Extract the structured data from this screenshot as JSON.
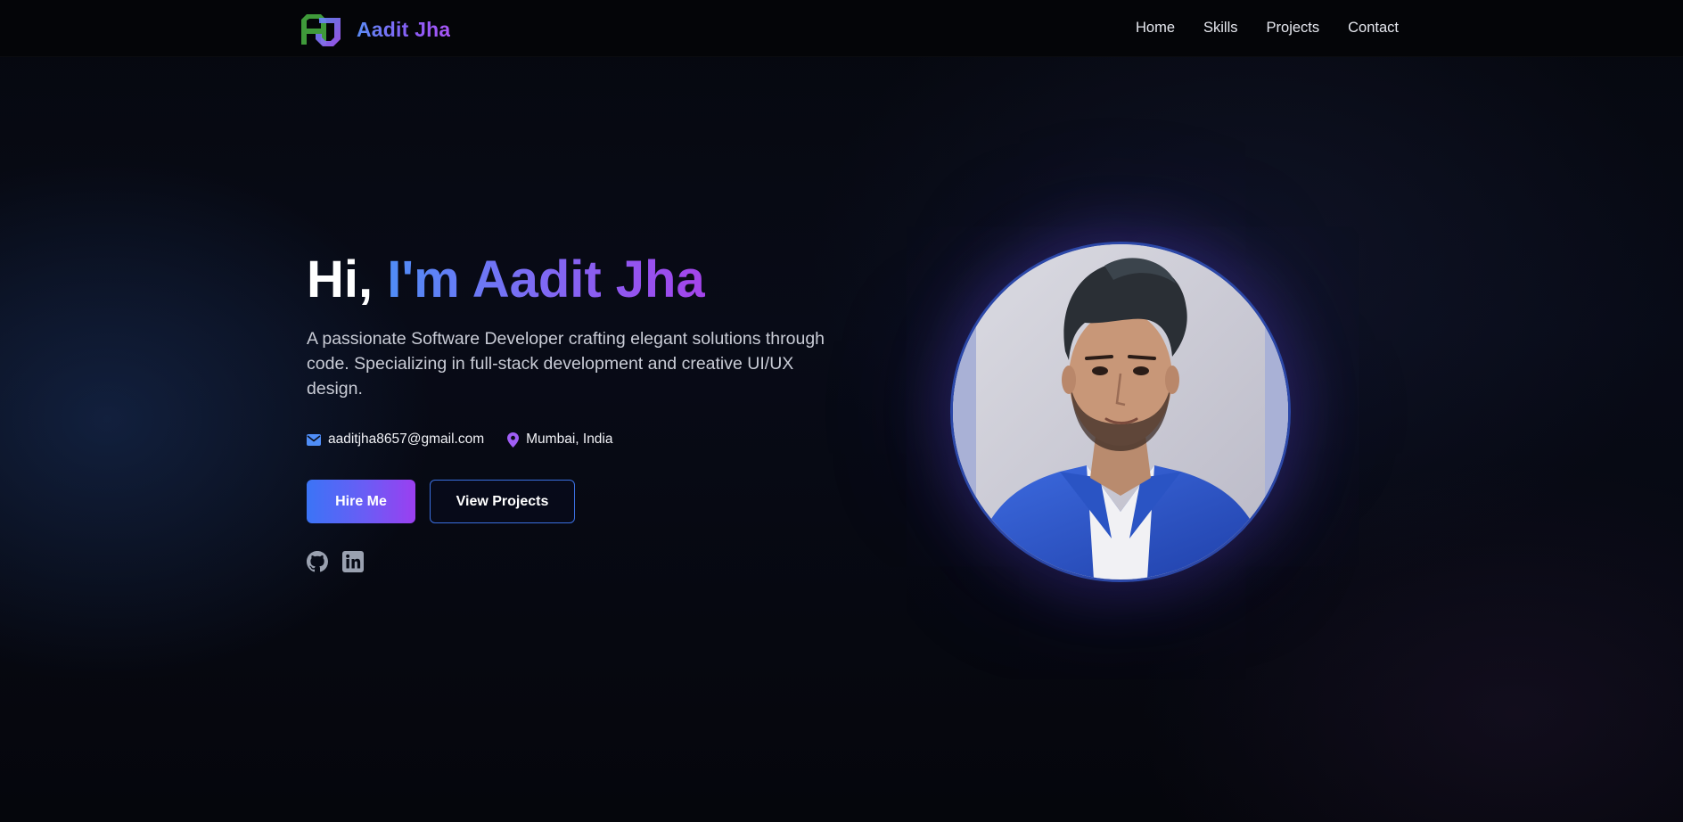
{
  "header": {
    "brand": "Aadit Jha",
    "logo_icon": "aj-monogram-logo",
    "nav": [
      {
        "label": "Home"
      },
      {
        "label": "Skills"
      },
      {
        "label": "Projects"
      },
      {
        "label": "Contact"
      }
    ]
  },
  "hero": {
    "greeting": "Hi,",
    "name": "I'm Aadit Jha",
    "tagline": "A passionate Software Developer crafting elegant solutions through code. Specializing in full-stack development and creative UI/UX design.",
    "email": "aaditjha8657@gmail.com",
    "location": "Mumbai, India",
    "email_icon": "envelope-icon",
    "location_icon": "map-pin-icon",
    "primary_button": "Hire Me",
    "secondary_button": "View Projects",
    "socials": [
      {
        "icon": "github-icon"
      },
      {
        "icon": "linkedin-icon"
      }
    ],
    "portrait": "profile-photo"
  },
  "colors": {
    "accent_blue": "#3b82f6",
    "accent_purple": "#9333ea",
    "background": "#05070d"
  }
}
